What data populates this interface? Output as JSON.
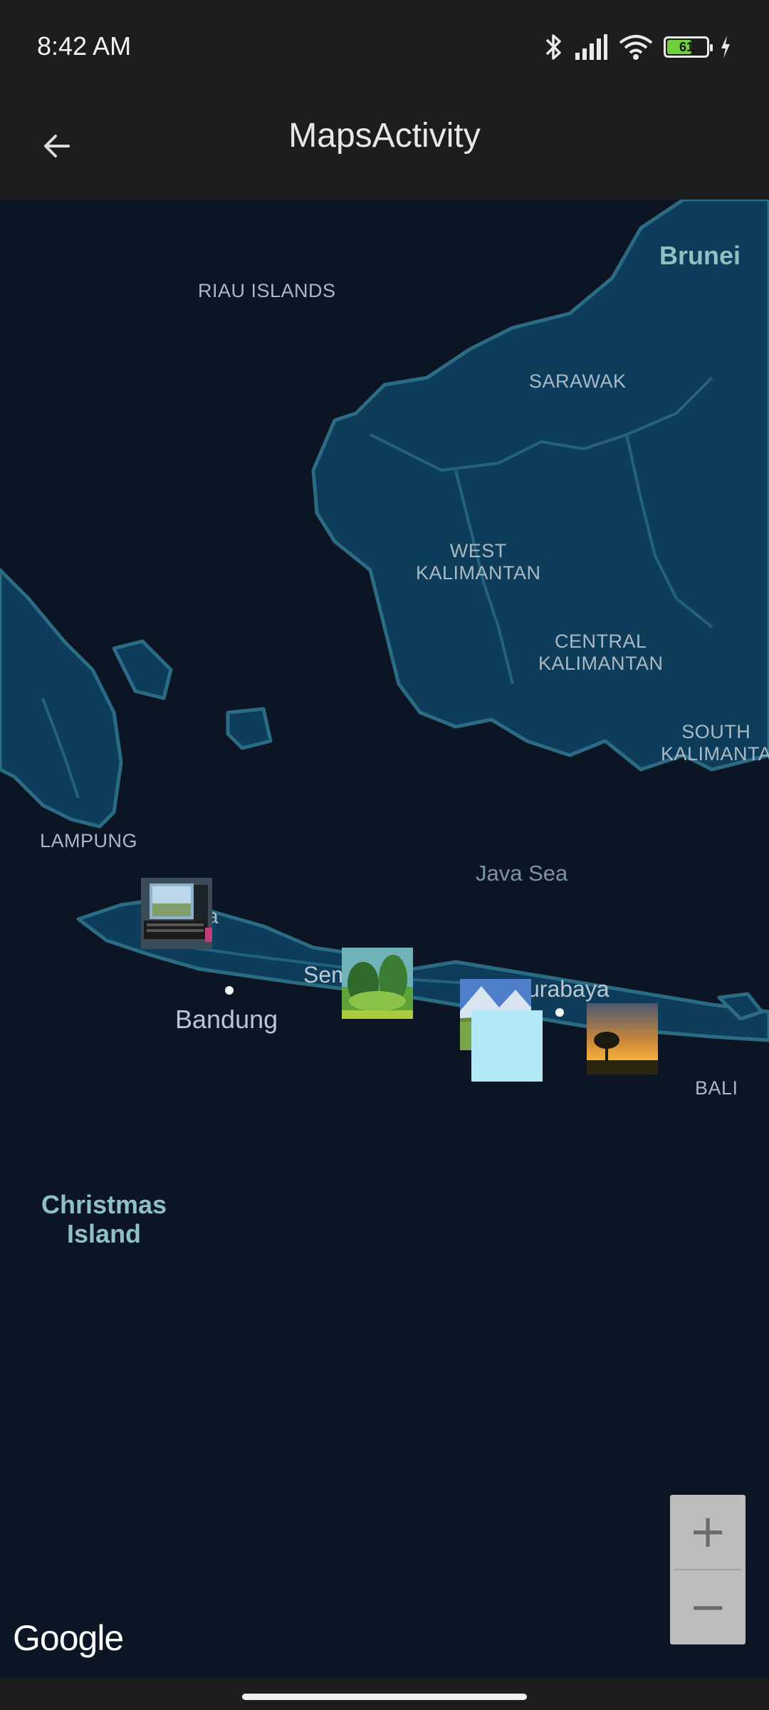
{
  "status_bar": {
    "time": "8:42 AM",
    "battery_level": 61,
    "battery_label": "61",
    "icons": [
      "bluetooth-icon",
      "signal-icon",
      "wifi-icon",
      "battery-icon",
      "charging-icon"
    ]
  },
  "app_bar": {
    "title": "MapsActivity",
    "back_icon": "arrow-left-icon"
  },
  "map": {
    "labels": {
      "brunei": "Brunei",
      "riau_islands": "RIAU ISLANDS",
      "sarawak": "SARAWAK",
      "west_kalimantan": "WEST\nKALIMANTAN",
      "central_kalimantan": "CENTRAL\nKALIMANTAN",
      "south_kalimantan": "SOUTH\nKALIMANTA",
      "lampung": "LAMPUNG",
      "java_sea": "Java Sea",
      "semarang": "Sem",
      "surabaya": "urabaya",
      "bandung": "Bandung",
      "bali": "BALI",
      "christmas_island": "Christmas\nIsland",
      "jakarta_fragment": "a"
    },
    "markers": [
      {
        "name": "computer-photo-marker",
        "description_icon": "typewriter-computer-thumbnail"
      },
      {
        "name": "forest-photo-marker",
        "description_icon": "green-forest-thumbnail"
      },
      {
        "name": "mountain-photo-marker",
        "description_icon": "mountain-lake-thumbnail"
      },
      {
        "name": "blank-photo-marker",
        "description_icon": "light-blue-square-thumbnail",
        "color": "#b3e8f6"
      },
      {
        "name": "sunset-photo-marker",
        "description_icon": "sunset-tree-thumbnail"
      }
    ],
    "colors": {
      "water": "#0b1523",
      "land": "#0e3c5b",
      "border": "#2b6c84"
    },
    "google_logo": "Google"
  },
  "zoom_controls": {
    "zoom_in": "+",
    "zoom_out": "−"
  }
}
